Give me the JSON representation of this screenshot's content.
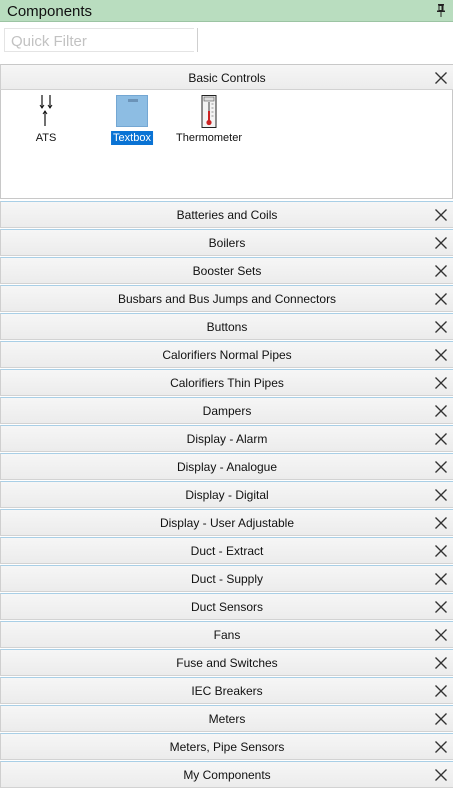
{
  "panel": {
    "title": "Components"
  },
  "filter": {
    "placeholder": "Quick Filter",
    "value": ""
  },
  "basic_controls": {
    "label": "Basic Controls",
    "items": [
      {
        "label": "ATS",
        "icon": "ats-icon",
        "selected": false
      },
      {
        "label": "Textbox",
        "icon": "textbox-icon",
        "selected": true
      },
      {
        "label": "Thermometer",
        "icon": "thermometer-icon",
        "selected": false
      }
    ]
  },
  "groups": [
    {
      "label": "Batteries and Coils"
    },
    {
      "label": "Boilers"
    },
    {
      "label": "Booster Sets"
    },
    {
      "label": "Busbars and Bus Jumps and Connectors"
    },
    {
      "label": "Buttons"
    },
    {
      "label": "Calorifiers Normal Pipes"
    },
    {
      "label": "Calorifiers Thin Pipes"
    },
    {
      "label": "Dampers"
    },
    {
      "label": "Display - Alarm"
    },
    {
      "label": "Display - Analogue"
    },
    {
      "label": "Display - Digital"
    },
    {
      "label": "Display - User Adjustable"
    },
    {
      "label": "Duct - Extract"
    },
    {
      "label": "Duct - Supply"
    },
    {
      "label": "Duct Sensors"
    },
    {
      "label": "Fans"
    },
    {
      "label": "Fuse and Switches"
    },
    {
      "label": "IEC Breakers"
    },
    {
      "label": "Meters"
    },
    {
      "label": "Meters, Pipe Sensors"
    },
    {
      "label": "My Components"
    }
  ],
  "colors": {
    "title_bar": "#b9ddbf",
    "selection": "#0a73d4",
    "header_border": "#a9cfe6"
  }
}
